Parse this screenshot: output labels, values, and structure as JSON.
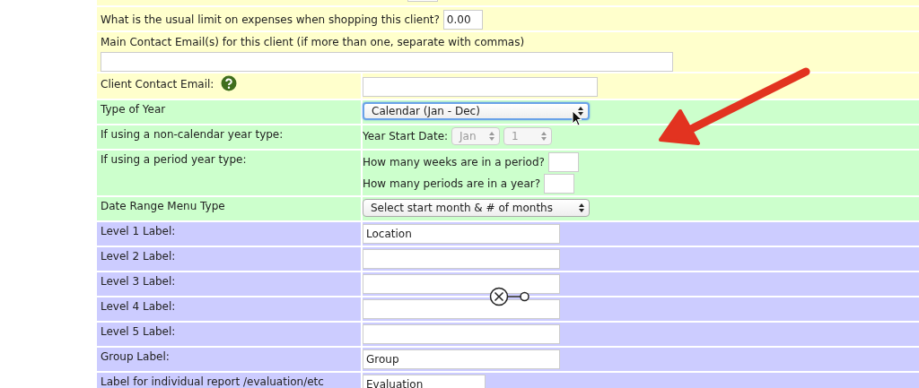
{
  "sections": [
    {
      "color": "#ffffcc",
      "rows": [
        {
          "kind": "cut",
          "controls": [
            [
              {
                "kind": "tiny"
              }
            ]
          ]
        },
        {
          "kind": "inline",
          "label": "What is the usual limit on expenses when shopping this client?",
          "controls": [
            [
              {
                "kind": "number",
                "value": "0.00"
              }
            ]
          ]
        },
        {
          "kind": "stacked",
          "label": "Main Contact Email(s) for this client (if more than one, separate with commas)",
          "controls": [
            [
              {
                "kind": "full-text"
              }
            ]
          ]
        },
        {
          "kind": "pair",
          "label": "Client Contact Email:",
          "help": true,
          "controls": [
            [
              {
                "kind": "long-text"
              }
            ]
          ]
        }
      ]
    },
    {
      "color": "#ccffcc",
      "rows": [
        {
          "kind": "pair",
          "label": "Type of Year",
          "controls": [
            [
              {
                "kind": "select",
                "value": "Calendar (Jan - Dec)",
                "focused": true,
                "disabled": false
              }
            ]
          ]
        },
        {
          "kind": "pair",
          "label": "If using a non-calendar year type:",
          "controls": [
            [
              {
                "kind": "caption",
                "text": "Year Start Date:"
              },
              {
                "kind": "small-select",
                "value": "Jan",
                "focused": false,
                "disabled": true
              },
              {
                "kind": "small-select",
                "value": "1",
                "focused": false,
                "disabled": true
              }
            ]
          ]
        },
        {
          "kind": "pair",
          "label": "If using a period year type:",
          "controls": [
            [
              {
                "kind": "caption",
                "text": "How many weeks are in a period?"
              },
              {
                "kind": "tiny"
              }
            ],
            [
              {
                "kind": "caption",
                "text": "How many periods are in a year?"
              },
              {
                "kind": "tiny"
              }
            ]
          ]
        },
        {
          "kind": "pair",
          "label": "Date Range Menu Type",
          "controls": [
            [
              {
                "kind": "select",
                "value": "Select start month & # of months",
                "focused": false,
                "disabled": false
              }
            ]
          ]
        }
      ]
    },
    {
      "color": "#ccccff",
      "rows": [
        {
          "kind": "pair",
          "label": "Level 1 Label:",
          "controls": [
            [
              {
                "kind": "text",
                "value": "Location"
              }
            ]
          ]
        },
        {
          "kind": "pair",
          "label": "Level 2 Label:",
          "controls": [
            [
              {
                "kind": "text"
              }
            ]
          ]
        },
        {
          "kind": "pair",
          "label": "Level 3 Label:",
          "controls": [
            [
              {
                "kind": "text"
              }
            ]
          ]
        },
        {
          "kind": "pair",
          "label": "Level 4 Label:",
          "controls": [
            [
              {
                "kind": "text"
              }
            ]
          ]
        },
        {
          "kind": "pair",
          "label": "Level 5 Label:",
          "controls": [
            [
              {
                "kind": "text"
              }
            ]
          ]
        },
        {
          "kind": "pair",
          "label": "Group Label:",
          "controls": [
            [
              {
                "kind": "text",
                "value": "Group"
              }
            ]
          ]
        },
        {
          "kind": "pair",
          "label": "Label for individual report /evaluation/etc",
          "controls": [
            [
              {
                "kind": "medium-text",
                "value": "Evaluation"
              }
            ]
          ]
        }
      ]
    }
  ],
  "overlays": [
    {
      "kind": "arrow"
    },
    {
      "kind": "cursor"
    },
    {
      "kind": "handle"
    }
  ]
}
